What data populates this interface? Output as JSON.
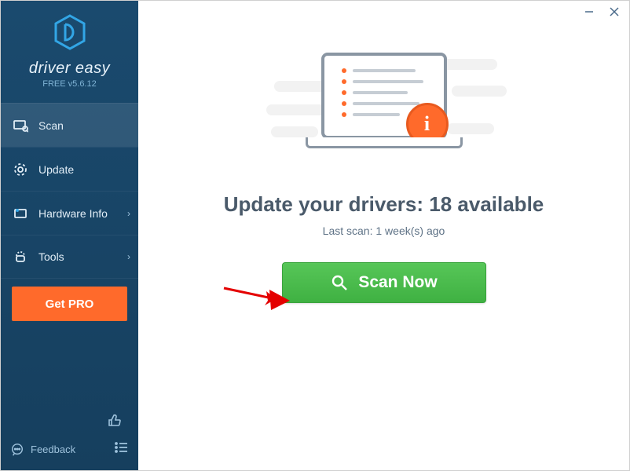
{
  "brand": {
    "name": "driver easy",
    "version": "FREE v5.6.12"
  },
  "sidebar": {
    "items": [
      {
        "label": "Scan",
        "icon": "scan-icon",
        "active": true,
        "chevron": false
      },
      {
        "label": "Update",
        "icon": "update-icon",
        "active": false,
        "chevron": false
      },
      {
        "label": "Hardware Info",
        "icon": "hardware-icon",
        "active": false,
        "chevron": true
      },
      {
        "label": "Tools",
        "icon": "tools-icon",
        "active": false,
        "chevron": true
      }
    ],
    "getpro_label": "Get PRO",
    "feedback_label": "Feedback"
  },
  "main": {
    "headline_prefix": "Update your drivers: ",
    "available_count": 18,
    "headline_suffix": " available",
    "lastscan_prefix": "Last scan: ",
    "lastscan_value": "1 week(s) ago",
    "scan_button_label": "Scan Now"
  },
  "colors": {
    "accent_orange": "#ff6a2b",
    "scan_green": "#4abf4d",
    "sidebar_bg": "#174560"
  }
}
